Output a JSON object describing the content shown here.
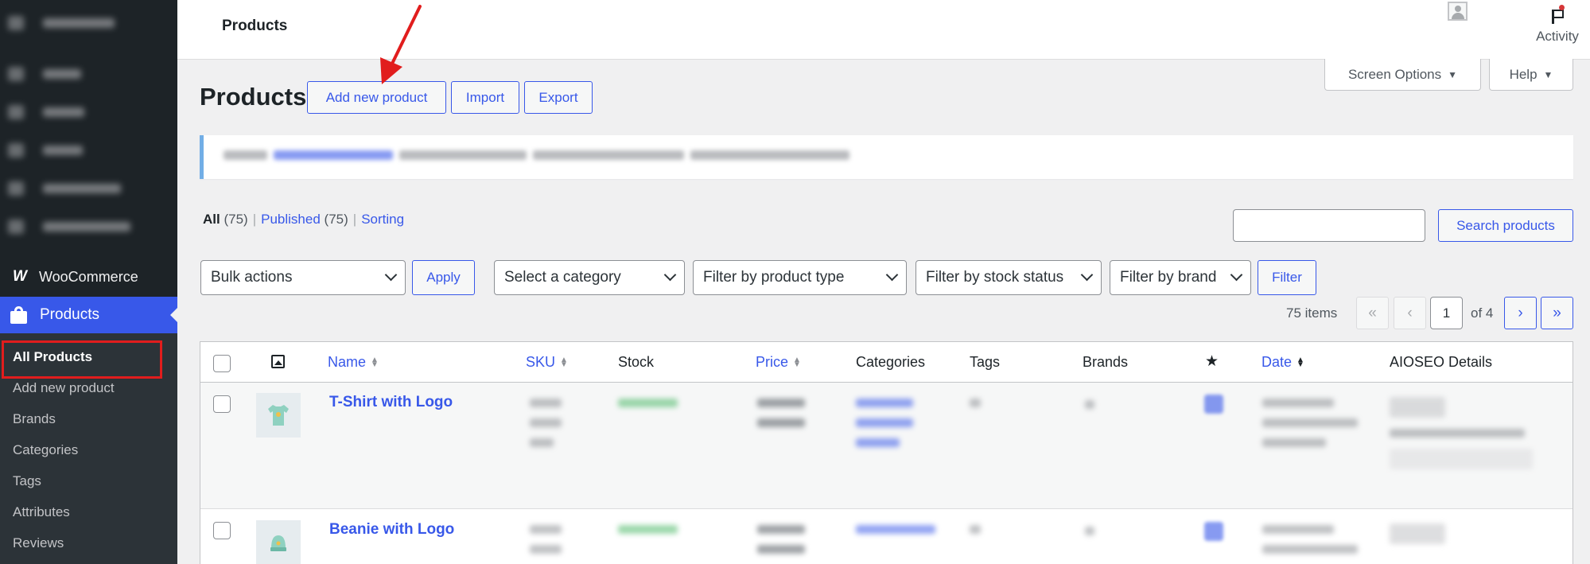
{
  "sidebar": {
    "woocommerce_label": "WooCommerce",
    "products_label": "Products",
    "submenu": [
      {
        "label": "All Products",
        "active": true
      },
      {
        "label": "Add new product"
      },
      {
        "label": "Brands"
      },
      {
        "label": "Categories"
      },
      {
        "label": "Tags"
      },
      {
        "label": "Attributes"
      },
      {
        "label": "Reviews"
      }
    ]
  },
  "topbar": {
    "title": "Products",
    "activity_label": "Activity"
  },
  "screen_options_label": "Screen Options",
  "help_label": "Help",
  "page": {
    "heading": "Products",
    "add_new_label": "Add new product",
    "import_label": "Import",
    "export_label": "Export"
  },
  "views": {
    "all_label": "All",
    "all_count": "(75)",
    "published_label": "Published",
    "published_count": "(75)",
    "sorting_label": "Sorting"
  },
  "search": {
    "value": "",
    "button_label": "Search products"
  },
  "filters": {
    "bulk_actions": "Bulk actions",
    "apply_label": "Apply",
    "category": "Select a category",
    "product_type": "Filter by product type",
    "stock_status": "Filter by stock status",
    "brand": "Filter by brand",
    "filter_label": "Filter"
  },
  "pagination": {
    "items": "75 items",
    "first": "«",
    "prev": "‹",
    "current": "1",
    "of": "of 4",
    "next": "›",
    "last": "»"
  },
  "table": {
    "columns": {
      "name": "Name",
      "sku": "SKU",
      "stock": "Stock",
      "price": "Price",
      "categories": "Categories",
      "tags": "Tags",
      "brands": "Brands",
      "date": "Date",
      "aioseo": "AIOSEO Details"
    },
    "rows": [
      {
        "name": "T-Shirt with Logo",
        "thumb_icon": "tshirt-icon"
      },
      {
        "name": "Beanie with Logo",
        "thumb_icon": "beanie-icon"
      }
    ]
  },
  "colors": {
    "accent": "#3858e9",
    "sidebar_bg": "#1d2327",
    "highlight_box": "#e11d1d"
  }
}
